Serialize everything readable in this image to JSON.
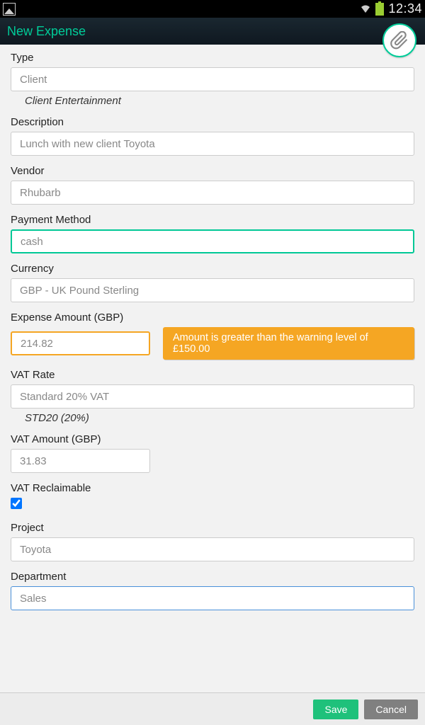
{
  "status": {
    "time": "12:34"
  },
  "title": "New Expense",
  "fields": {
    "type": {
      "label": "Type",
      "value": "Client",
      "hint": "Client Entertainment"
    },
    "description": {
      "label": "Description",
      "value": "Lunch with new client Toyota"
    },
    "vendor": {
      "label": "Vendor",
      "value": "Rhubarb"
    },
    "payment_method": {
      "label": "Payment Method",
      "value": "cash"
    },
    "currency": {
      "label": "Currency",
      "value": "GBP - UK Pound Sterling"
    },
    "expense_amount": {
      "label": "Expense Amount (GBP)",
      "value": "214.82"
    },
    "warning": "Amount is greater than the warning level of £150.00",
    "vat_rate": {
      "label": "VAT Rate",
      "value": "Standard 20% VAT",
      "hint": "STD20 (20%)"
    },
    "vat_amount": {
      "label": "VAT Amount (GBP)",
      "value": "31.83"
    },
    "vat_reclaimable": {
      "label": "VAT Reclaimable",
      "checked": true
    },
    "project": {
      "label": "Project",
      "value": "Toyota"
    },
    "department": {
      "label": "Department",
      "value": "Sales"
    }
  },
  "footer": {
    "save": "Save",
    "cancel": "Cancel"
  }
}
